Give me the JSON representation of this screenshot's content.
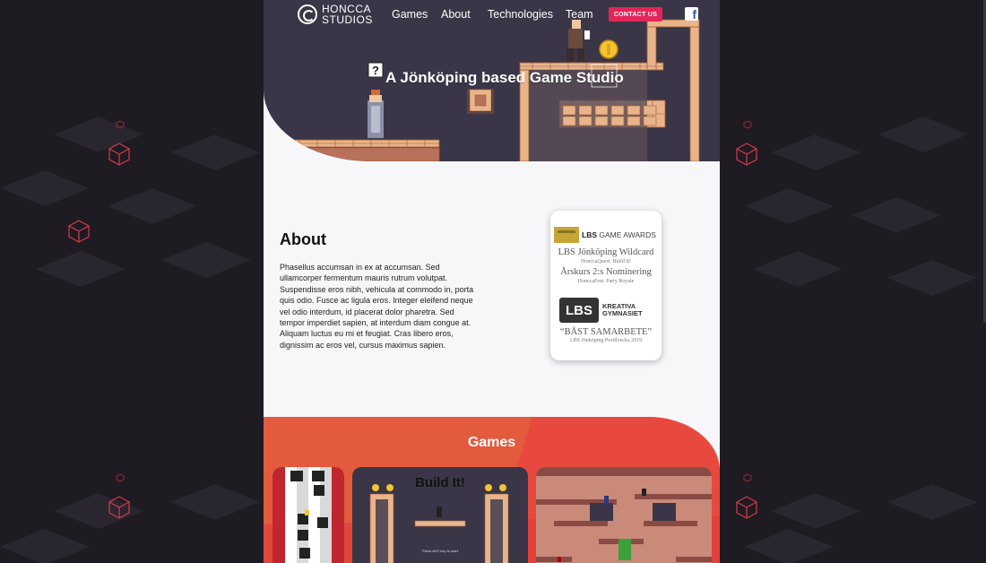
{
  "brand": {
    "line1": "HONCCA",
    "line2": "STUDIOS"
  },
  "nav": {
    "games": "Games",
    "about": "About",
    "technologies": "Technologies",
    "team": "Team",
    "contact": "CONTACT US",
    "facebook": "f"
  },
  "hero": {
    "title": "A Jönköping based Game Studio",
    "question_block": "?"
  },
  "about": {
    "title": "About",
    "text": "Phasellus accumsan in ex at accumsan. Sed ullamcorper fermentum mauris rutrum volutpat. Suspendisse eros nibh, vehicula at commodo in, porta quis odio. Fusce ac ligula eros. Integer eleifend neque vel odio interdum, id placerat dolor pharetra. Sed tempor imperdiet sapien, at interdum diam congue at. Aliquam luctus eu mi et feugiat. Cras libero eros, dignissim ac eros vel, cursus maximus sapien."
  },
  "awards": {
    "header_bold": "LBS",
    "header_rest": "GAME AWARDS",
    "award1_title": "LBS Jönköping Wildcard",
    "award1_sub": "HonccaQuest: Build It!",
    "award2_title": "Årskurs 2:s Nominering",
    "award2_sub": "HonccaFest: Party Royale",
    "lbs_logo": "LBS",
    "lbs_line1": "KREATIVA",
    "lbs_line2": "GYMNASIET",
    "award3_title": "“BÄST SAMARBETE”",
    "award3_sub": "LBS Jönköping Profilvecka 2019"
  },
  "games": {
    "title": "Games",
    "card2_title": "Build It!",
    "card2_press": "Press ANY key to start"
  },
  "colors": {
    "hero_bg": "#3b3647",
    "accent": "#e3265a",
    "games_bg": "#e35a3c",
    "page_bg": "#f7f7fa",
    "brick": "#e9b48a"
  }
}
